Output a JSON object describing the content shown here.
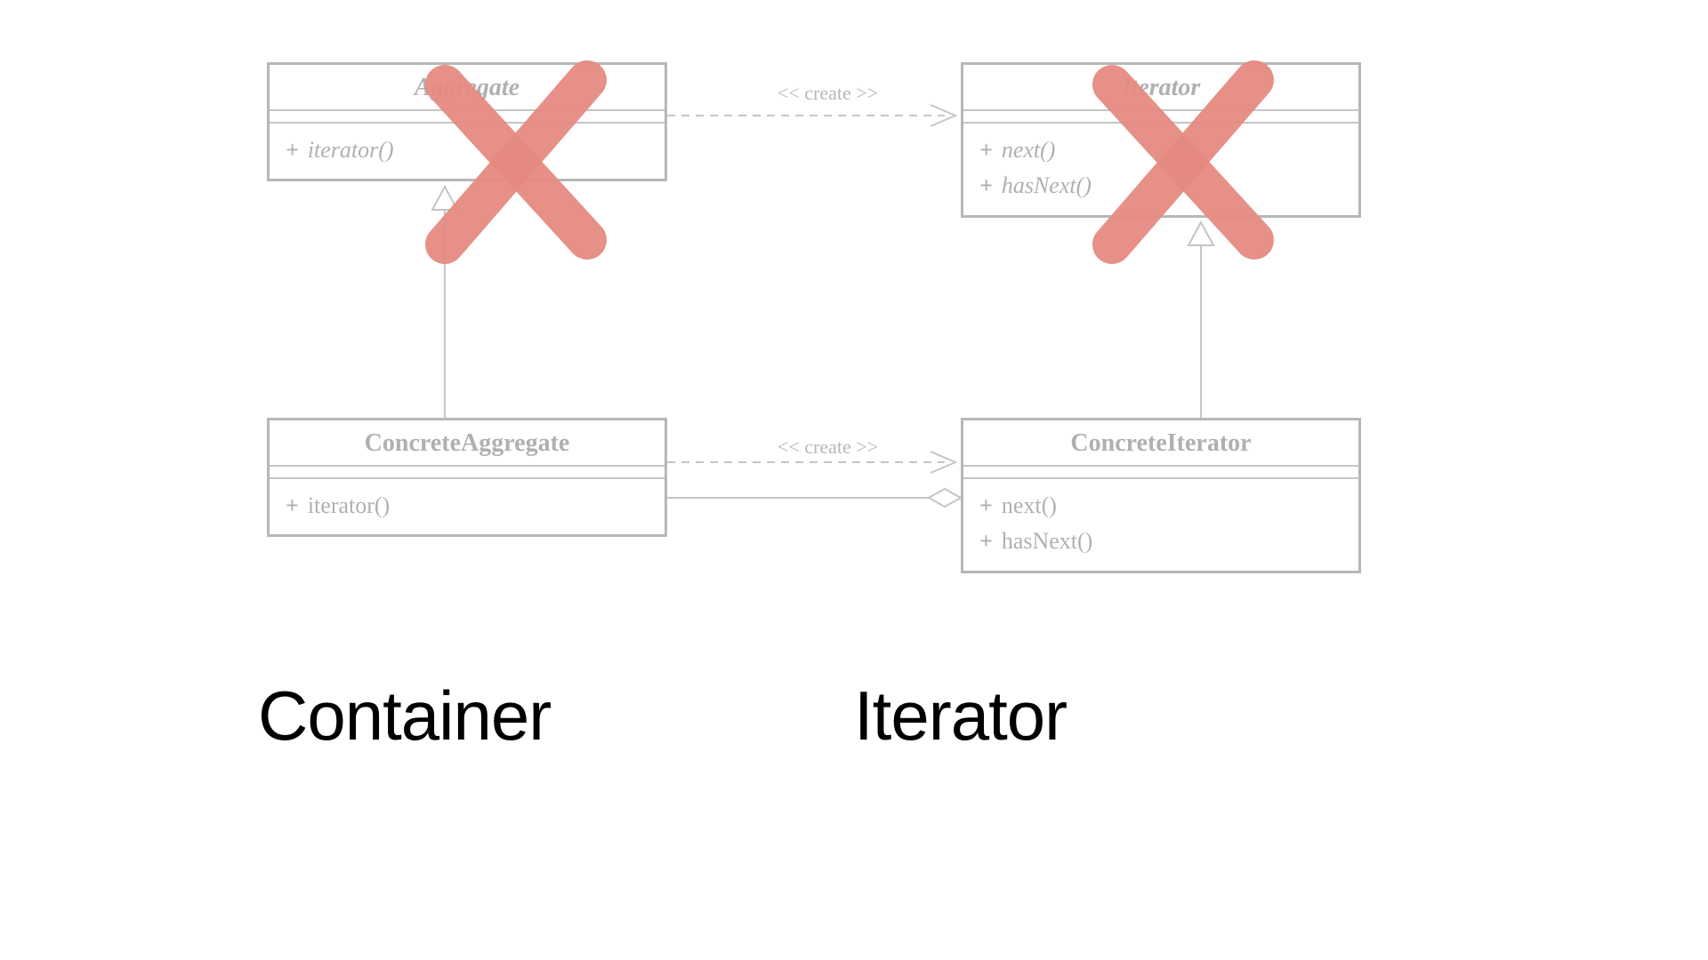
{
  "boxes": {
    "aggregate": {
      "title": "Aggregate",
      "methods": [
        "iterator()"
      ]
    },
    "iterator": {
      "title": "Iterator",
      "methods": [
        "next()",
        "hasNext()"
      ]
    },
    "concreteAggregate": {
      "title": "ConcreteAggregate",
      "methods": [
        "iterator()"
      ]
    },
    "concreteIterator": {
      "title": "ConcreteIterator",
      "methods": [
        "next()",
        "hasNext()"
      ]
    }
  },
  "relations": {
    "createTop": "<< create >>",
    "createBottom": "<< create >>"
  },
  "captions": {
    "container": "Container",
    "iterator": "Iterator"
  }
}
